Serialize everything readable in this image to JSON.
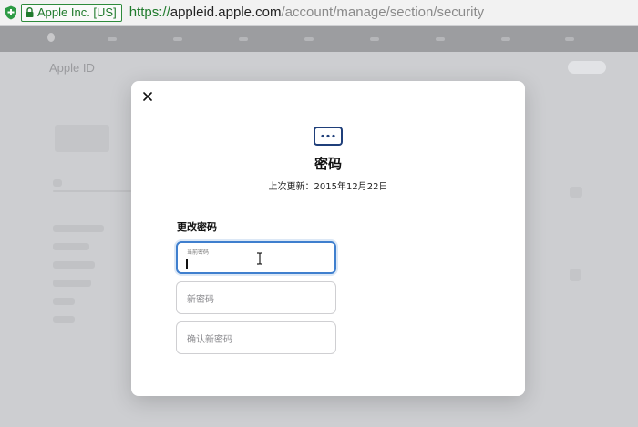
{
  "browser": {
    "cert_label": "Apple Inc. [US]",
    "url_scheme": "https://",
    "url_host": "appleid.apple.com",
    "url_path": "/account/manage/section/security"
  },
  "background": {
    "page_title": "Apple ID"
  },
  "dialog": {
    "title": "密码",
    "last_updated": "上次更新：2015年12月22日",
    "section_title": "更改密码",
    "current_password_label": "当前密码",
    "new_password_placeholder": "新密码",
    "confirm_password_placeholder": "确认新密码"
  },
  "colors": {
    "accent": "#3f7fce",
    "secure_green": "#1f7a2c",
    "icon_navy": "#1f3f7a"
  }
}
